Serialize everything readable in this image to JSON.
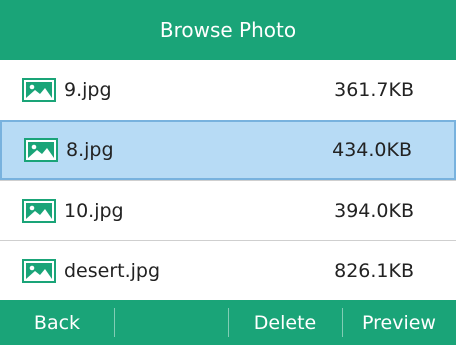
{
  "title": "Browse Photo",
  "files": [
    {
      "name": "9.jpg",
      "size": "361.7KB",
      "icon": "image-file-icon",
      "selected": false
    },
    {
      "name": "8.jpg",
      "size": "434.0KB",
      "icon": "image-file-icon",
      "selected": true
    },
    {
      "name": "10.jpg",
      "size": "394.0KB",
      "icon": "image-file-icon",
      "selected": false
    },
    {
      "name": "desert.jpg",
      "size": "826.1KB",
      "icon": "image-file-icon",
      "selected": false
    }
  ],
  "softkeys": {
    "back": "Back",
    "empty": "",
    "delete": "Delete",
    "preview": "Preview"
  },
  "colors": {
    "accent": "#1aa478",
    "selection": "#b7dbf5",
    "selection_border": "#78b2de",
    "icon": "#1aa478"
  }
}
